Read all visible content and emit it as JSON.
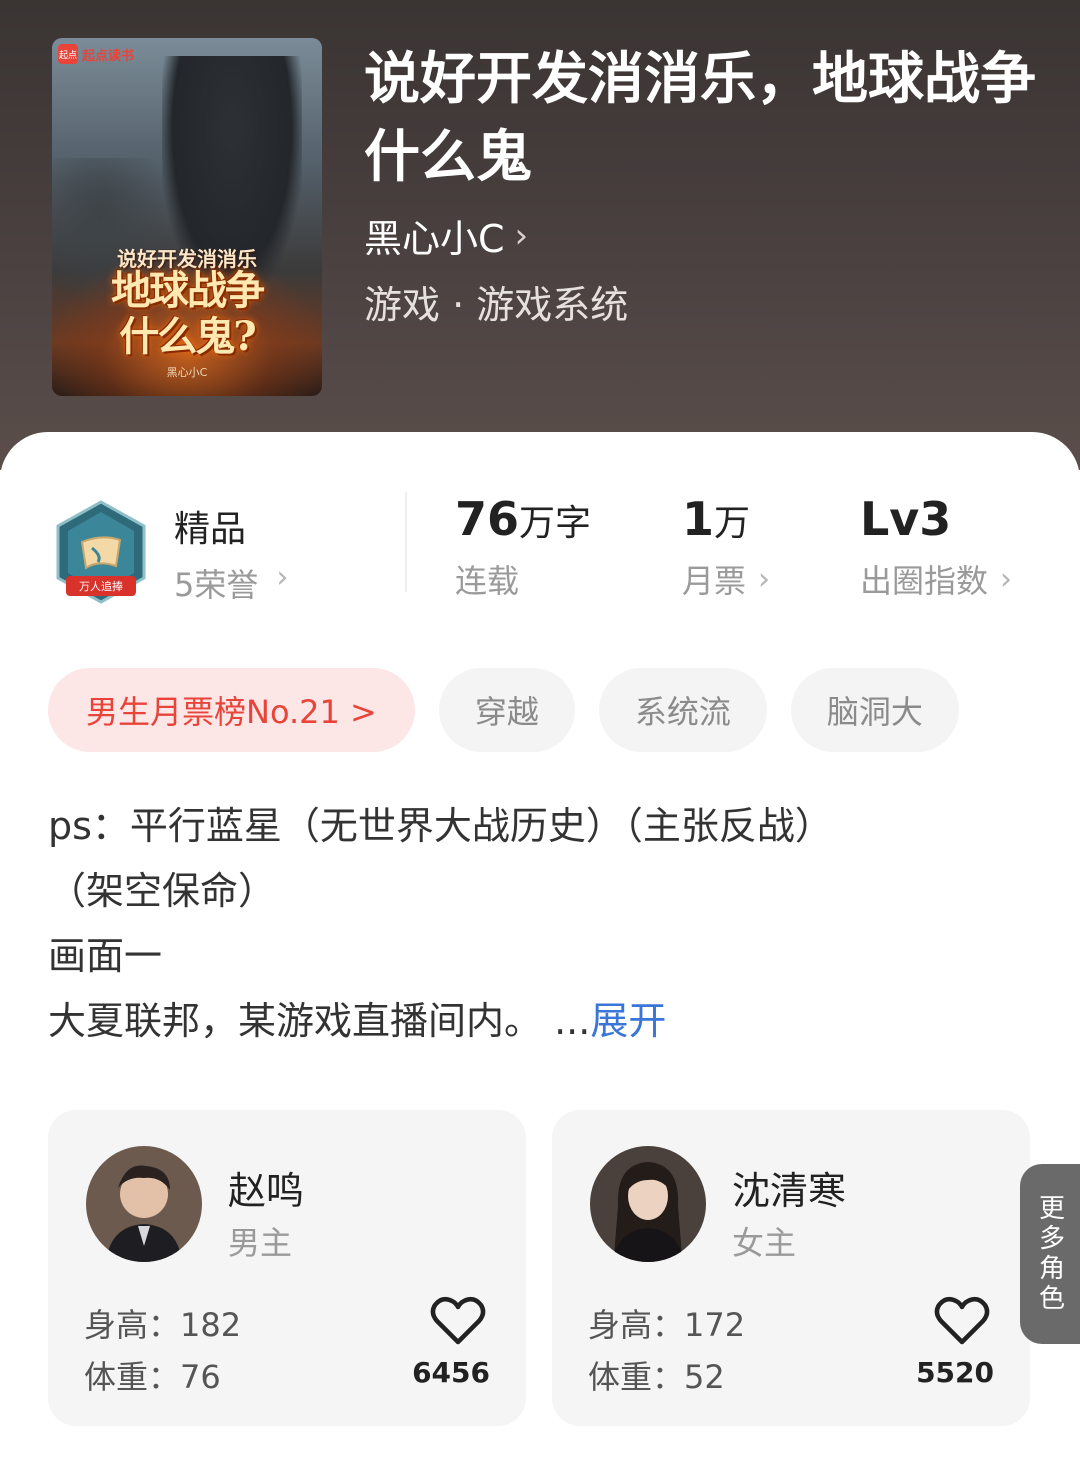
{
  "book": {
    "title": "说好开发消消乐，地球战争什么鬼",
    "author": "黑心小C",
    "genre": "游戏 · 游戏系统",
    "cover": {
      "brand": "起点读书",
      "brand_logo": "起点",
      "title_small": "说好开发消消乐",
      "title_big_1": "地球战争",
      "title_big_2": "什么鬼?",
      "author": "黑心小C"
    }
  },
  "stats": {
    "honor": {
      "title": "精品",
      "sub": "5荣誉",
      "badge": "万人追捧"
    },
    "words": {
      "num": "76",
      "unit": "万字",
      "label": "连载"
    },
    "tickets": {
      "num": "1",
      "unit": "万",
      "label": "月票"
    },
    "level": {
      "num": "Lv3",
      "label": "出圈指数"
    }
  },
  "tags": {
    "rank": "男生月票榜No.21 >",
    "items": [
      "穿越",
      "系统流",
      "脑洞大"
    ]
  },
  "intro": {
    "line1": "ps：平行蓝星（无世界大战历史）（主张反战）",
    "line2": "（架空保命）",
    "line3": "画面一",
    "line4": "大夏联邦，某游戏直播间内。 ...",
    "expand": "展开"
  },
  "characters": [
    {
      "name": "赵鸣",
      "role": "男主",
      "height": "身高：182",
      "weight": "体重：76",
      "likes": "6456"
    },
    {
      "name": "沈清寒",
      "role": "女主",
      "height": "身高：172",
      "weight": "体重：52",
      "likes": "5520"
    }
  ],
  "more_roles": "更多角色",
  "icons": {
    "chevron": "chevron-right-icon",
    "heart": "heart-outline-icon",
    "honor": "honor-badge-icon"
  },
  "colors": {
    "accent_red": "#e8443a",
    "link_blue": "#3a76d8"
  }
}
